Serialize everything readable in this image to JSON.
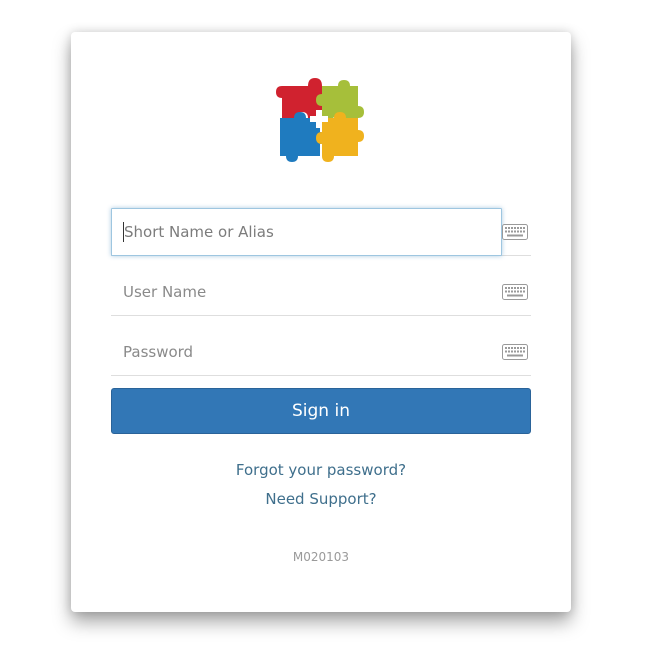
{
  "logo": {
    "name": "puzzle-logo",
    "colors": [
      "#d0222f",
      "#a6bf3a",
      "#1f7bbf",
      "#f0b21e"
    ]
  },
  "form": {
    "short_name_placeholder": "Short Name or Alias",
    "username_placeholder": "User Name",
    "password_placeholder": "Password",
    "keyboard_icon": "keyboard-icon",
    "signin_label": "Sign in"
  },
  "links": {
    "forgot_password": "Forgot your password?",
    "need_support": "Need Support?"
  },
  "version": "M020103",
  "colors": {
    "accent": "#3277b6",
    "link": "#3f6f8c"
  }
}
